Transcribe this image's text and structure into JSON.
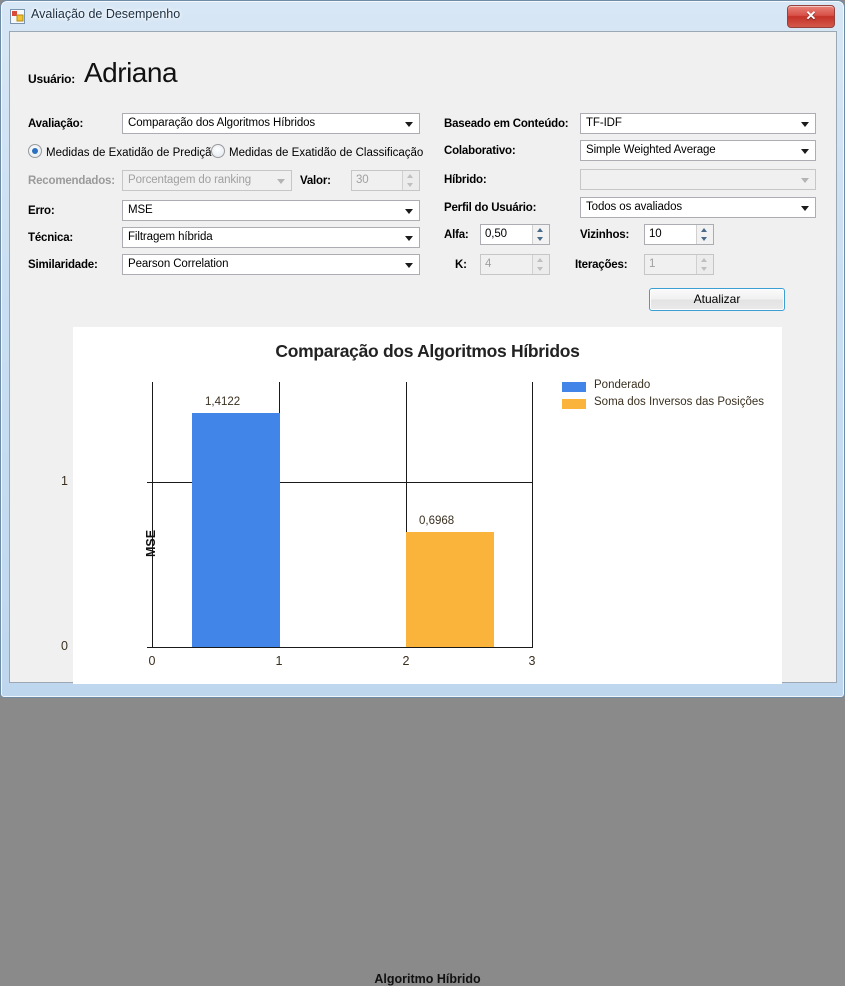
{
  "window": {
    "title": "Avaliação de Desempenho",
    "icon": "form-icon",
    "close_label": "✕"
  },
  "form": {
    "user_label": "Usuário:",
    "user_name": "Adriana",
    "avaliacao_label": "Avaliação:",
    "avaliacao_value": "Comparação dos Algoritmos Híbridos",
    "radio_predicao": "Medidas de Exatidão de Predição",
    "radio_classificacao": "Medidas de Exatidão de Classificação",
    "recomendados_label": "Recomendados:",
    "recomendados_value": "Porcentagem do ranking",
    "valor_label": "Valor:",
    "valor_value": "30",
    "erro_label": "Erro:",
    "erro_value": "MSE",
    "tecnica_label": "Técnica:",
    "tecnica_value": "Filtragem híbrida",
    "similaridade_label": "Similaridade:",
    "similaridade_value": "Pearson Correlation",
    "conteudo_label": "Baseado em Conteúdo:",
    "conteudo_value": "TF-IDF",
    "colaborativo_label": "Colaborativo:",
    "colaborativo_value": "Simple Weighted Average",
    "hibrido_label": "Híbrido:",
    "hibrido_value": "",
    "perfil_label": "Perfil do Usuário:",
    "perfil_value": "Todos os avaliados",
    "alfa_label": "Alfa:",
    "alfa_value": "0,50",
    "vizinhos_label": "Vizinhos:",
    "vizinhos_value": "10",
    "k_label": "K:",
    "k_value": "4",
    "iteracoes_label": "Iterações:",
    "iteracoes_value": "1",
    "atualizar_label": "Atualizar"
  },
  "colors": {
    "series1": "#4285e8",
    "series2": "#fab43c",
    "accent": "#3c9fd4"
  },
  "chart_data": {
    "type": "bar",
    "title": "Comparação dos Algoritmos Híbridos",
    "xlabel": "Algoritmo Híbrido",
    "ylabel": "MSE",
    "x": [
      0.5,
      2.25
    ],
    "values": [
      1.4122,
      0.6968
    ],
    "labels": [
      "1,4122",
      "0,6968"
    ],
    "series": [
      {
        "name": "Ponderado",
        "color": "#4285e8",
        "x": 0.5,
        "value": 1.4122,
        "label": "1,4122"
      },
      {
        "name": "Soma dos Inversos das Posições",
        "color": "#fab43c",
        "x": 2.25,
        "value": 0.6968,
        "label": "0,6968"
      }
    ],
    "xticks": [
      "0",
      "1",
      "2",
      "3"
    ],
    "yticks": [
      "0",
      "1"
    ],
    "xlim": [
      0,
      3
    ],
    "ylim": [
      0,
      1.6
    ],
    "grid": true,
    "legend_position": "right",
    "legend": [
      "Ponderado",
      "Soma dos Inversos das Posições"
    ]
  }
}
